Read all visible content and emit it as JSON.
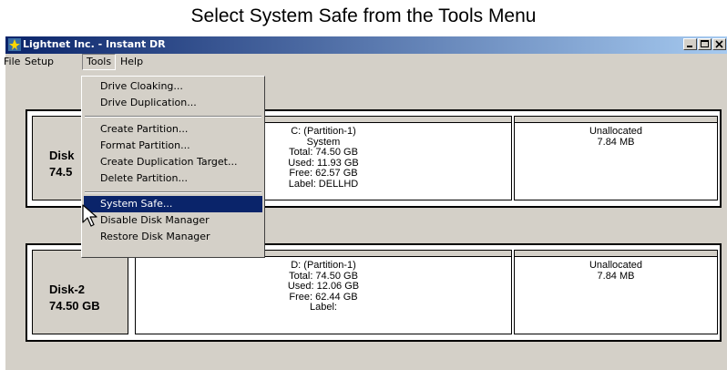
{
  "caption": "Select System Safe from the Tools Menu",
  "window": {
    "title": "Lightnet Inc. - Instant DR",
    "controls": [
      "minimize",
      "maximize",
      "close"
    ]
  },
  "menubar": {
    "file": "File",
    "setup": "Setup",
    "tools": "Tools",
    "help": "Help"
  },
  "tools_menu": {
    "items": [
      "Drive Cloaking...",
      "Drive Duplication...",
      "Create Partition...",
      "Format Partition...",
      "Create Duplication Target...",
      "Delete Partition...",
      "System Safe...",
      "Disable Disk Manager",
      "Restore Disk Manager"
    ],
    "selected": "System Safe..."
  },
  "disks": [
    {
      "name": "Disk",
      "size": "74.5",
      "partitions": [
        {
          "lines": [
            "C: (Partition-1)",
            "System",
            "Total: 74.50 GB",
            "Used: 11.93 GB",
            "Free: 62.57 GB",
            "Label: DELLHD"
          ]
        },
        {
          "lines": [
            "Unallocated",
            "7.84 MB"
          ]
        }
      ]
    },
    {
      "name": "Disk-2",
      "size": "74.50 GB",
      "partitions": [
        {
          "lines": [
            "D: (Partition-1)",
            "Total: 74.50 GB",
            "Used: 12.06 GB",
            "Free: 62.44 GB",
            "Label:"
          ]
        },
        {
          "lines": [
            "Unallocated",
            "7.84 MB"
          ]
        }
      ]
    }
  ],
  "colors": {
    "titlebar_start": "#0a246a",
    "titlebar_end": "#a6caf0",
    "face": "#d4d0c8",
    "highlight": "#0a246a"
  }
}
